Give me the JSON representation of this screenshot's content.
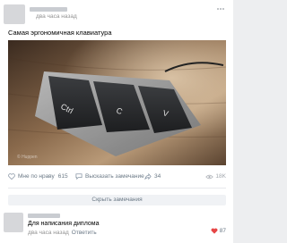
{
  "post": {
    "time": "два часа назад",
    "text": "Самая эргономичная клавиатура",
    "watermark": "© Huppen",
    "keys": [
      "Ctrl",
      "C",
      "V"
    ]
  },
  "actions": {
    "like_label": "Мне по нраву",
    "like_count": "615",
    "comment_label": "Высказать замечание",
    "share_count": "34",
    "views": "18K"
  },
  "comments": {
    "hide_label": "Скрыть замечания",
    "item": {
      "text": "Для написания диплома",
      "time": "два часа назад",
      "reply_label": "Ответить",
      "likes": "87"
    }
  },
  "colors": {
    "accent": "#6a7885",
    "heart": "#e64646",
    "background": "#edeef0"
  }
}
